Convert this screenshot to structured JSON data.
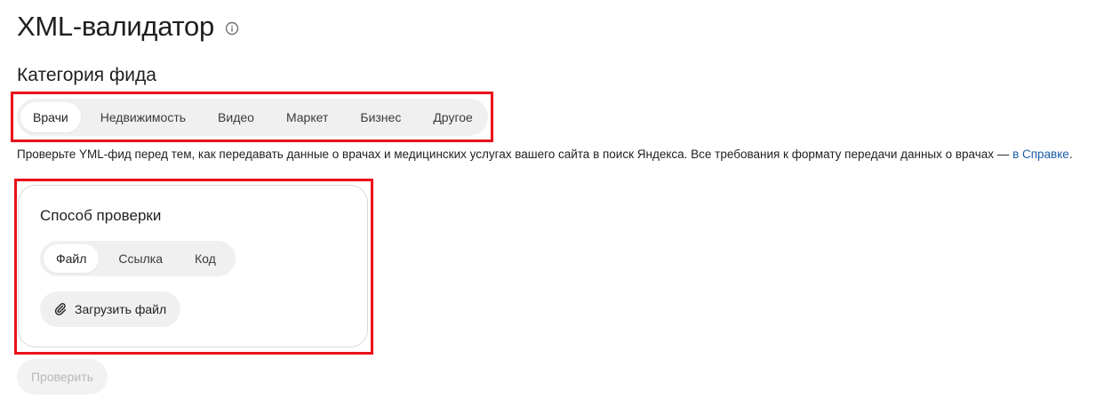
{
  "header": {
    "title": "XML-валидатор",
    "info_icon": "info-icon"
  },
  "category": {
    "title": "Категория фида",
    "tabs": [
      {
        "label": "Врачи",
        "active": true
      },
      {
        "label": "Недвижимость",
        "active": false
      },
      {
        "label": "Видео",
        "active": false
      },
      {
        "label": "Маркет",
        "active": false
      },
      {
        "label": "Бизнес",
        "active": false
      },
      {
        "label": "Другое",
        "active": false
      }
    ]
  },
  "description": {
    "text": "Проверьте YML-фид перед тем, как передавать данные о врачах и медицинских услугах вашего сайта в поиск Яндекса. Все требования к формату передачи данных о врачах — ",
    "link_text": "в Справке",
    "end": "."
  },
  "method": {
    "title": "Способ проверки",
    "tabs": [
      {
        "label": "Файл",
        "active": true
      },
      {
        "label": "Ссылка",
        "active": false
      },
      {
        "label": "Код",
        "active": false
      }
    ],
    "upload_label": "Загрузить файл",
    "upload_icon": "paperclip-icon"
  },
  "actions": {
    "check_label": "Проверить",
    "check_disabled": true
  },
  "colors": {
    "highlight": "#e8111b",
    "link": "#1a5ca8",
    "segment_bg": "#f0f0f0",
    "disabled_text": "#b8b8b8"
  }
}
